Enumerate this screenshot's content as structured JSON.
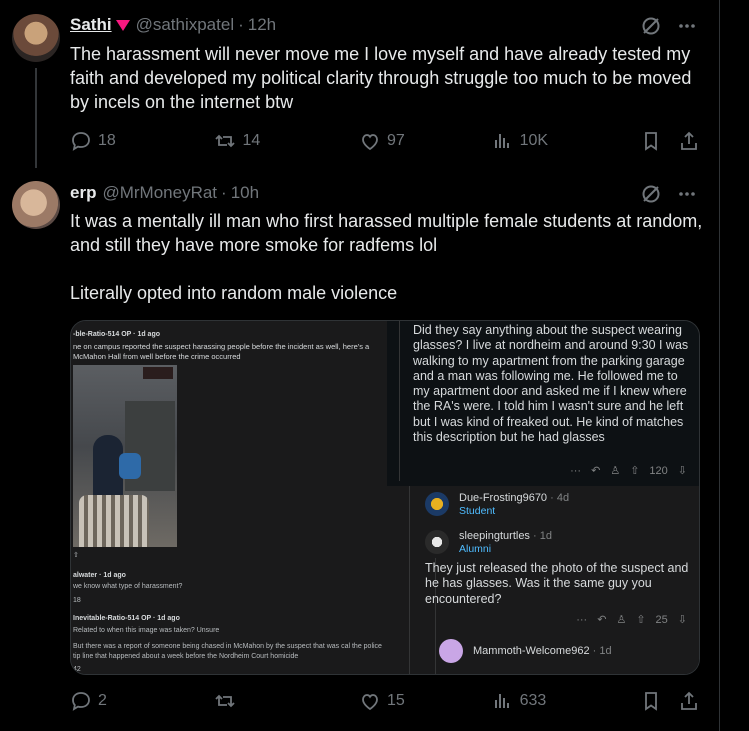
{
  "tweet1": {
    "name": "Sathi",
    "handle": "@sathixpatel",
    "time": "12h",
    "text": "The harassment will never move me I love myself and have already tested my faith and developed my political clarity through struggle too much to be moved by incels on the internet btw",
    "replies": "18",
    "reposts": "14",
    "likes": "97",
    "views": "10K"
  },
  "tweet2": {
    "name": "erp",
    "handle": "@MrMoneyRat",
    "time": "10h",
    "text1": "It was a mentally ill man who first harassed multiple female students at random, and still they have more smoke for radfems lol",
    "text2": "Literally opted into random male violence",
    "replies": "2",
    "reposts": "",
    "likes": "15",
    "views": "633"
  },
  "media": {
    "left": {
      "user": "-ble-Ratio-514 OP · 1d ago",
      "text": "ne on campus reported the suspect harassing people before the incident as well, here's a McMahon Hall from well before the crime occurred",
      "c1_user": "alwater · 1d ago",
      "c1_text": "we know what type of harassment?",
      "c1_votes": "18",
      "c2_user": "Inevitable-Ratio-514 OP · 1d ago",
      "c2_text": "Related to when this image was taken? Unsure",
      "c2_text2": "But there was a report of someone being chased in McMahon by the suspect that was cal the police tip line that happened about a week before the Nordheim Court homicide",
      "c2_votes": "42"
    },
    "right": {
      "post_text": "Did they say anything about the suspect wearing glasses?  I live at nordheim and around 9:30 I was walking to my apartment from the parking garage and a man was following me. He followed me to my apartment door and asked me if I knew where the RA's were. I told him I wasn't sure and he left but I was kind of freaked out. He kind of matches this description but he had glasses",
      "post_votes": "120",
      "u1": "Due-Frosting9670",
      "u1_time": "· 4d",
      "u1_flair": "Student",
      "u2": "sleepingturtles",
      "u2_time": "· 1d",
      "u2_flair": "Alumni",
      "reply_text": "They just released the photo of the suspect and he has glasses. Was it the same guy you encountered?",
      "reply_votes": "25",
      "u3": "Mammoth-Welcome962",
      "u3_time": "· 1d"
    }
  },
  "colors": {
    "background": "#000000",
    "text": "#e7e9ea",
    "muted": "#71767b",
    "verified": "#f91880",
    "flair": "#4fbcff"
  }
}
